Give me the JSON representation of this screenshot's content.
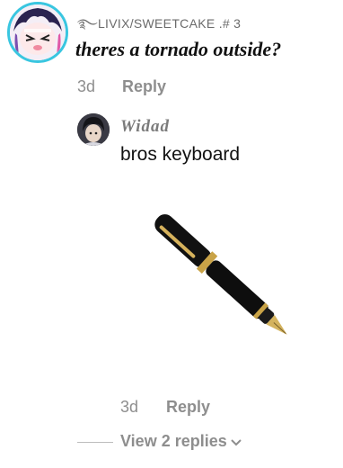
{
  "comment": {
    "username": "࿐LIVIX/SWEETCAKE .# 3",
    "text": "theres a tornado outside?",
    "time": "3d",
    "reply_label": "Reply",
    "avatar_icon": "anime-avatar-icon"
  },
  "reply": {
    "username": "Widad",
    "text": "bros keyboard",
    "time": "3d",
    "reply_label": "Reply",
    "avatar_icon": "dark-hair-avatar-icon",
    "image": "fountain-pen-image"
  },
  "thread": {
    "view_replies_label": "View 2 replies",
    "chevron_icon": "chevron-down-icon"
  },
  "colors": {
    "avatar_ring": "#39c6e0",
    "muted_text": "#8e8e8e",
    "pen_body": "#111111",
    "pen_trim": "#c9a347"
  }
}
